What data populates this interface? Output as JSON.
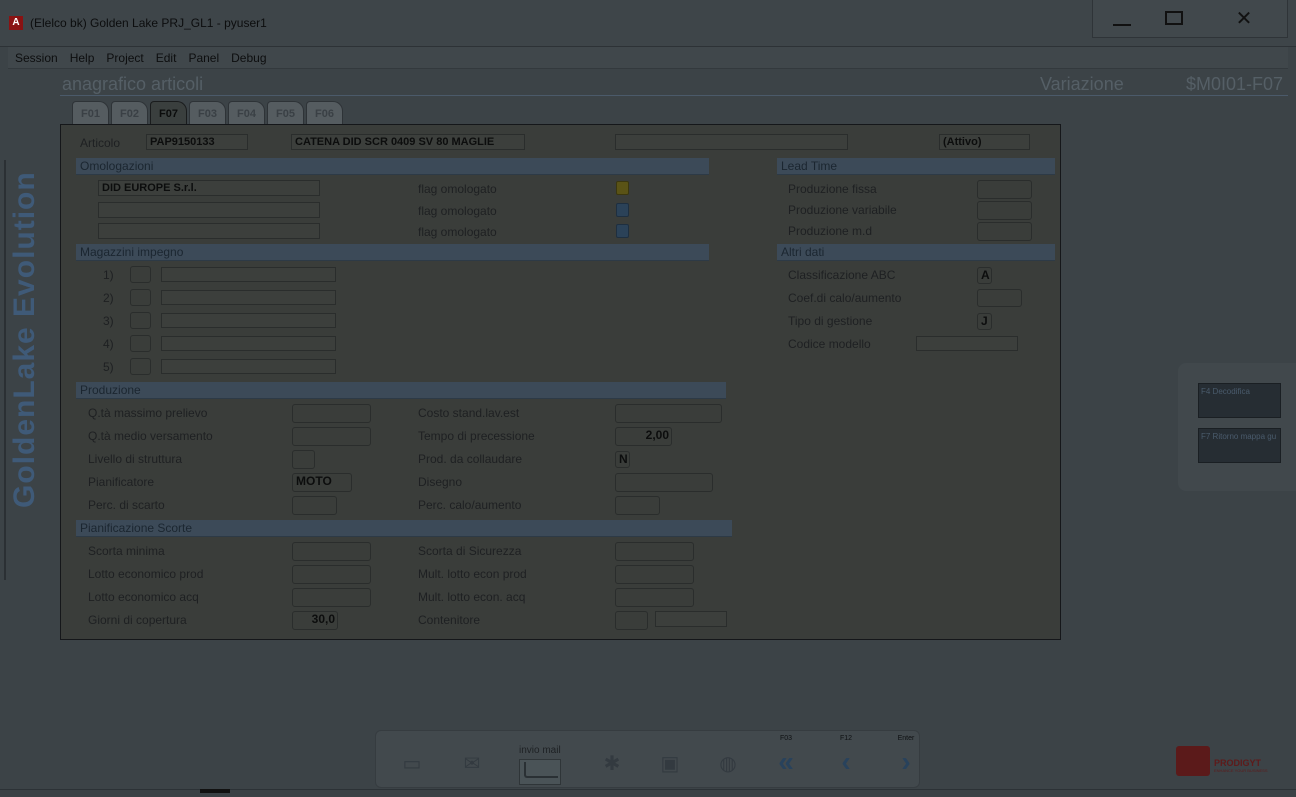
{
  "window": {
    "title": "(Elelco bk) Golden Lake PRJ_GL1 - pyuser1",
    "app_icon": "A",
    "close_glyph": "✕"
  },
  "menu": [
    "Session",
    "Help",
    "Project",
    "Edit",
    "Panel",
    "Debug"
  ],
  "brand": {
    "side_text": "GoldenLake Evolution"
  },
  "header": {
    "title": "anagrafico articoli",
    "mode": "Variazione",
    "code": "$M0I01-F07"
  },
  "tabs": [
    "F01",
    "F02",
    "F07",
    "F03",
    "F04",
    "F05",
    "F06"
  ],
  "active_tab": "F07",
  "article": {
    "label": "Articolo",
    "code": "PAP9150133",
    "description": "CATENA DID SCR 0409 SV    80 MAGLIE",
    "extra": "",
    "status": "(Attivo)"
  },
  "omologazioni": {
    "title": "Omologazioni",
    "rows": [
      {
        "name": "DID EUROPE S.r.l.",
        "flag_label": "flag omologato",
        "flag_color": "#5a5316"
      },
      {
        "name": "",
        "flag_label": "flag omologato",
        "flag_color": "#2b4258"
      },
      {
        "name": "",
        "flag_label": "flag omologato",
        "flag_color": "#2b4258"
      }
    ]
  },
  "magazzini": {
    "title": "Magazzini impegno",
    "rows": [
      "1)",
      "2)",
      "3)",
      "4)",
      "5)"
    ]
  },
  "lead_time": {
    "title": "Lead Time",
    "fields": [
      {
        "label": "Produzione fissa",
        "value": ""
      },
      {
        "label": "Produzione variabile",
        "value": ""
      },
      {
        "label": "Produzione m.d",
        "value": ""
      }
    ]
  },
  "altri_dati": {
    "title": "Altri dati",
    "classificazione_label": "Classificazione ABC",
    "classificazione_value": "A",
    "coef_label": "Coef.di calo/aumento",
    "coef_value": "",
    "tipo_label": "Tipo di gestione",
    "tipo_value": "J",
    "modello_label": "Codice modello",
    "modello_value": ""
  },
  "produzione": {
    "title": "Produzione",
    "left": [
      {
        "label": "Q.tà massimo prelievo",
        "value": ""
      },
      {
        "label": "Q.tà medio versamento",
        "value": ""
      },
      {
        "label": "Livello di struttura",
        "value": ""
      },
      {
        "label": "Pianificatore",
        "value": "MOTO"
      },
      {
        "label": "Perc. di scarto",
        "value": ""
      }
    ],
    "right": [
      {
        "label": "Costo stand.lav.est",
        "value": ""
      },
      {
        "label": "Tempo di precessione",
        "value": "2,00"
      },
      {
        "label": "Prod. da collaudare",
        "value": "N"
      },
      {
        "label": "Disegno",
        "value": ""
      },
      {
        "label": "Perc. calo/aumento",
        "value": ""
      }
    ]
  },
  "pianificazione": {
    "title": "Pianificazione Scorte",
    "left": [
      {
        "label": "Scorta minima",
        "value": ""
      },
      {
        "label": "Lotto economico prod",
        "value": ""
      },
      {
        "label": "Lotto economico acq",
        "value": ""
      },
      {
        "label": "Giorni di copertura",
        "value": "30,0"
      }
    ],
    "right": [
      {
        "label": "Scorta di Sicurezza",
        "value": ""
      },
      {
        "label": "Mult. lotto econ prod",
        "value": ""
      },
      {
        "label": "Mult. lotto econ. acq",
        "value": ""
      },
      {
        "label": "Contenitore",
        "value": ""
      }
    ]
  },
  "side_actions": [
    "F4 Decodifica",
    "F7 Ritorno mappa gu"
  ],
  "toolbar": {
    "invio_label": "invio mail",
    "fkeys": [
      {
        "label": "F03",
        "icon": "«"
      },
      {
        "label": "F12",
        "icon": "‹"
      },
      {
        "label": "Enter",
        "icon": "›"
      }
    ]
  },
  "logo": {
    "text": "PRODIGYT",
    "subtext": "ENHANCE YOUR BUSINESS"
  }
}
